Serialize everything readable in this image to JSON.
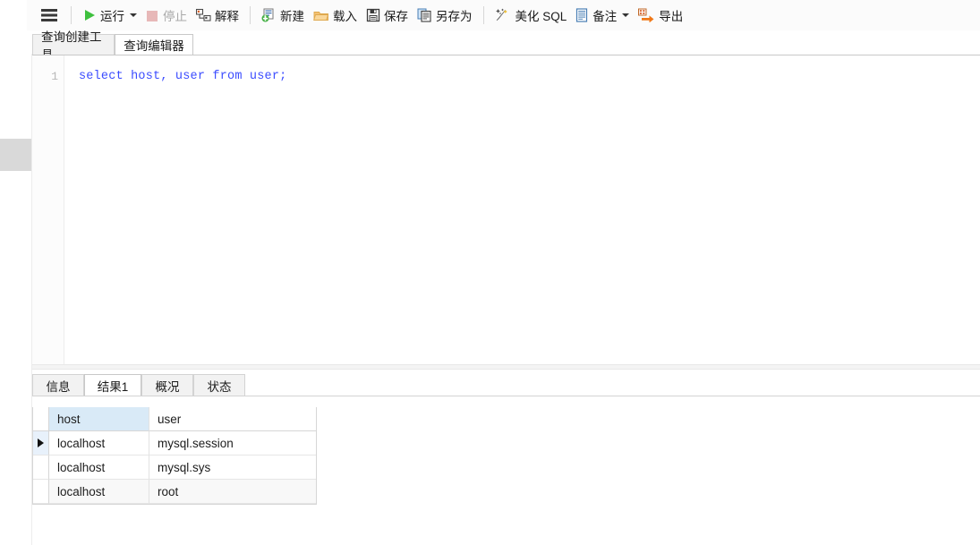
{
  "toolbar": {
    "menu_icon": "hamburger-icon",
    "items": [
      {
        "id": "run",
        "label": "运行",
        "icon": "play-icon",
        "has_caret": true,
        "disabled": false
      },
      {
        "id": "stop",
        "label": "停止",
        "icon": "stop-square-icon",
        "has_caret": false,
        "disabled": true
      },
      {
        "id": "explain",
        "label": "解释",
        "icon": "explain-plan-icon",
        "has_caret": false,
        "disabled": false
      },
      {
        "id": "new",
        "label": "新建",
        "icon": "new-document-icon",
        "has_caret": false,
        "disabled": false
      },
      {
        "id": "load",
        "label": "载入",
        "icon": "folder-open-icon",
        "has_caret": false,
        "disabled": false
      },
      {
        "id": "save",
        "label": "保存",
        "icon": "floppy-save-icon",
        "has_caret": false,
        "disabled": false
      },
      {
        "id": "save_as",
        "label": "另存为",
        "icon": "save-as-copy-icon",
        "has_caret": false,
        "disabled": false
      },
      {
        "id": "beautify",
        "label": "美化 SQL",
        "icon": "magic-wand-icon",
        "has_caret": false,
        "disabled": false
      },
      {
        "id": "remark",
        "label": "备注",
        "icon": "note-document-icon",
        "has_caret": true,
        "disabled": false
      },
      {
        "id": "export",
        "label": "导出",
        "icon": "export-arrow-icon",
        "has_caret": false,
        "disabled": false
      }
    ]
  },
  "top_tabs": [
    {
      "id": "query-builder",
      "label": "查询创建工具",
      "active": false
    },
    {
      "id": "query-editor",
      "label": "查询编辑器",
      "active": true
    }
  ],
  "editor": {
    "line_number": "1",
    "sql": "select host, user from user;"
  },
  "bottom_tabs": [
    {
      "id": "message",
      "label": "信息",
      "active": false
    },
    {
      "id": "result1",
      "label": "结果1",
      "active": true
    },
    {
      "id": "profile",
      "label": "概况",
      "active": false
    },
    {
      "id": "status",
      "label": "状态",
      "active": false
    }
  ],
  "result_grid": {
    "columns": [
      "host",
      "user"
    ],
    "selected_column": "host",
    "current_row_index": 0,
    "rows": [
      [
        "localhost",
        "mysql.session"
      ],
      [
        "localhost",
        "mysql.sys"
      ],
      [
        "localhost",
        "root"
      ]
    ]
  },
  "colors": {
    "toolbar_bg": "#fbfbfb",
    "sql_text": "#3b4cff",
    "header_selected_bg": "#d9eaf7",
    "current_row_bg": "#e8f1fb",
    "run_icon": "#3ec03e",
    "folder_icon": "#f0b95a",
    "export_icon": "#f07818"
  }
}
